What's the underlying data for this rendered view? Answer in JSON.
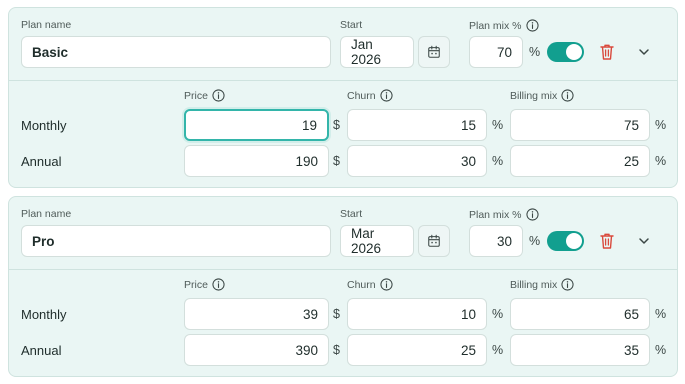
{
  "labels": {
    "plan_name": "Plan name",
    "start": "Start",
    "plan_mix": "Plan mix %",
    "price": "Price",
    "churn": "Churn",
    "billing_mix": "Billing mix",
    "currency_unit": "$",
    "percent_unit": "%"
  },
  "plans": [
    {
      "name": "Basic",
      "start": "Jan 2026",
      "mix": "70",
      "enabled": true,
      "rows": [
        {
          "label": "Monthly",
          "price": "19",
          "churn": "15",
          "billing_mix": "75"
        },
        {
          "label": "Annual",
          "price": "190",
          "churn": "30",
          "billing_mix": "25"
        }
      ]
    },
    {
      "name": "Pro",
      "start": "Mar 2026",
      "mix": "30",
      "enabled": true,
      "rows": [
        {
          "label": "Monthly",
          "price": "39",
          "churn": "10",
          "billing_mix": "65"
        },
        {
          "label": "Annual",
          "price": "390",
          "churn": "25",
          "billing_mix": "35"
        }
      ]
    }
  ],
  "icons": {
    "info": "info-icon",
    "calendar": "calendar-icon",
    "trash": "trash-icon",
    "chevron": "chevron-down-icon"
  },
  "colors": {
    "accent": "#129f8f",
    "focus": "#33b5aa",
    "danger": "#d9483b",
    "card_bg": "#eaf6f4"
  }
}
